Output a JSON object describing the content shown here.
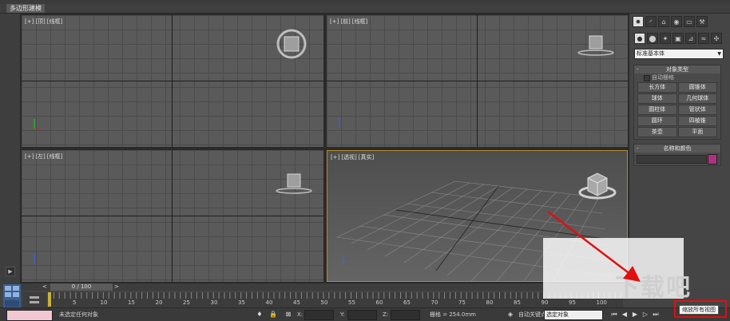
{
  "window": {
    "tab_label": "多边形建模"
  },
  "viewports": {
    "top_left": {
      "plus": "[+]",
      "view": "[顶]",
      "shade": "[线框]"
    },
    "top_right": {
      "plus": "[+]",
      "view": "[前]",
      "shade": "[线框]"
    },
    "bottom_left": {
      "plus": "[+]",
      "view": "[左]",
      "shade": "[线框]"
    },
    "bottom_right": {
      "plus": "[+]",
      "view": "[透视]",
      "shade": "[真实]"
    }
  },
  "command_panel": {
    "top_icons": [
      "sun-icon",
      "curve-icon",
      "hierarchy-icon",
      "motion-icon",
      "display-icon",
      "hammer-icon"
    ],
    "sub_icons": [
      "sphere-icon",
      "shapes-icon",
      "light-icon",
      "camera-icon",
      "helper-icon",
      "spacewarp-icon",
      "systems-icon"
    ],
    "category_dropdown": "标准基本体",
    "object_type": {
      "title": "对象类型",
      "autogrid": "自动栅格",
      "buttons": [
        "长方体",
        "圆锥体",
        "球体",
        "几何球体",
        "圆柱体",
        "管状体",
        "圆环",
        "四棱锥",
        "茶壶",
        "平面"
      ]
    },
    "name_color": {
      "title": "名称和颜色",
      "swatch_color": "#b03082"
    }
  },
  "timeline": {
    "frame_display": "0 / 100",
    "ticks": [
      "5",
      "10",
      "15",
      "20",
      "25",
      "30",
      "35",
      "40",
      "45",
      "50",
      "55",
      "60",
      "65",
      "70",
      "75",
      "80",
      "85",
      "90",
      "95",
      "100"
    ]
  },
  "status": {
    "message": "未选定任何对象",
    "x_label": "X:",
    "y_label": "Y:",
    "z_label": "Z:",
    "grid": "栅格 = 254.0mm",
    "auto_key": "自动关键点",
    "selection_dropdown": "选定对象",
    "tooltip": "缩放所有视图"
  },
  "watermark": {
    "text": "下载吧"
  },
  "colors": {
    "accent_highlight": "#e01010",
    "viewport_active_border": "#b38b2a",
    "logo": "#3b5f8f"
  }
}
